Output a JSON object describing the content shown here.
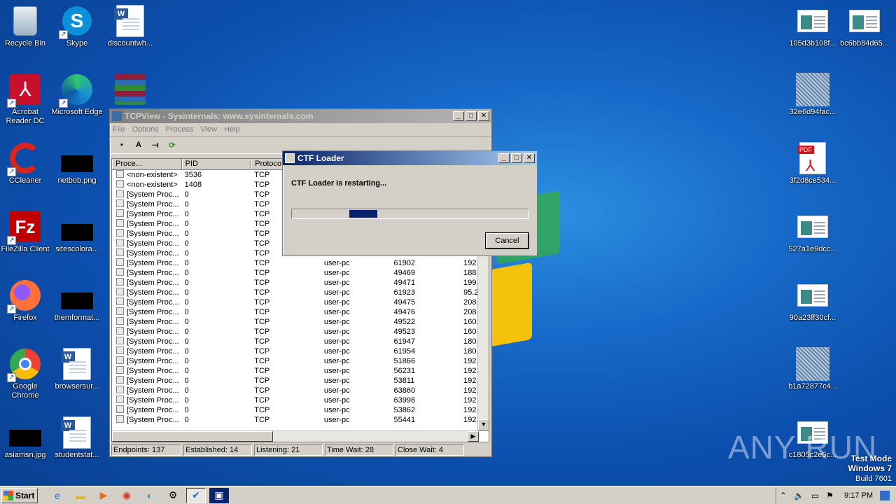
{
  "desktop_left": [
    {
      "label": "Recycle Bin",
      "icon": "recycle-bin-icon"
    },
    {
      "label": "Skype",
      "icon": "skype-icon"
    },
    {
      "label": "discountwh...",
      "icon": "word-doc-icon"
    },
    {
      "label": "Acrobat Reader DC",
      "icon": "acrobat-icon"
    },
    {
      "label": "Microsoft Edge",
      "icon": "edge-icon"
    },
    {
      "label": "",
      "icon": "winrar-icon"
    },
    {
      "label": "CCleaner",
      "icon": "ccleaner-icon"
    },
    {
      "label": "netbob.png",
      "icon": "image-file-icon"
    },
    {
      "label": "FileZilla Client",
      "icon": "filezilla-icon"
    },
    {
      "label": "sitescolora...",
      "icon": "image-file-icon"
    },
    {
      "label": "Firefox",
      "icon": "firefox-icon"
    },
    {
      "label": "themformat...",
      "icon": "image-file-icon"
    },
    {
      "label": "Google Chrome",
      "icon": "chrome-icon"
    },
    {
      "label": "browsersur...",
      "icon": "word-doc-icon"
    },
    {
      "label": "asiamsn.jpg",
      "icon": "image-file-icon"
    },
    {
      "label": "studentstat...",
      "icon": "word-doc-icon"
    }
  ],
  "desktop_right": [
    {
      "label": "105d3b108f...",
      "icon": "screenshot-file-icon"
    },
    {
      "label": "bc6bb84d65...",
      "icon": "screenshot-file-icon"
    },
    {
      "label": "32e6d94fac...",
      "icon": "image-file-icon"
    },
    {
      "label": "3f2d8ce534...",
      "icon": "pdf-icon"
    },
    {
      "label": "527a1e9dcc...",
      "icon": "screenshot-file-icon"
    },
    {
      "label": "90a23ff30cf...",
      "icon": "screenshot-file-icon"
    },
    {
      "label": "b1a72877c4...",
      "icon": "image-file-icon"
    },
    {
      "label": "c1805c2e5c...",
      "icon": "screenshot-file-icon"
    }
  ],
  "tcpview": {
    "title": "TCPView - Sysinternals: www.sysinternals.com",
    "menu": [
      "File",
      "Options",
      "Process",
      "View",
      "Help"
    ],
    "columns": [
      "Proce...",
      "PID",
      "Protoco",
      "",
      "",
      ""
    ],
    "rows": [
      [
        "<non-existent>",
        "3536",
        "TCP",
        "",
        "",
        ""
      ],
      [
        "<non-existent>",
        "1408",
        "TCP",
        "",
        "",
        ""
      ],
      [
        "[System Proc...",
        "0",
        "TCP",
        "",
        "",
        ""
      ],
      [
        "[System Proc...",
        "0",
        "TCP",
        "",
        "",
        ""
      ],
      [
        "[System Proc...",
        "0",
        "TCP",
        "",
        "",
        ""
      ],
      [
        "[System Proc...",
        "0",
        "TCP",
        "",
        "",
        ""
      ],
      [
        "[System Proc...",
        "0",
        "TCP",
        "",
        "",
        ""
      ],
      [
        "[System Proc...",
        "0",
        "TCP",
        "",
        "",
        ""
      ],
      [
        "[System Proc...",
        "0",
        "TCP",
        "",
        "",
        ""
      ],
      [
        "[System Proc...",
        "0",
        "TCP",
        "user-pc",
        "61902",
        "192."
      ],
      [
        "[System Proc...",
        "0",
        "TCP",
        "user-pc",
        "49469",
        "188."
      ],
      [
        "[System Proc...",
        "0",
        "TCP",
        "user-pc",
        "49471",
        "199."
      ],
      [
        "[System Proc...",
        "0",
        "TCP",
        "user-pc",
        "61923",
        "95.2"
      ],
      [
        "[System Proc...",
        "0",
        "TCP",
        "user-pc",
        "49475",
        "208."
      ],
      [
        "[System Proc...",
        "0",
        "TCP",
        "user-pc",
        "49476",
        "208."
      ],
      [
        "[System Proc...",
        "0",
        "TCP",
        "user-pc",
        "49522",
        "160."
      ],
      [
        "[System Proc...",
        "0",
        "TCP",
        "user-pc",
        "49523",
        "160."
      ],
      [
        "[System Proc...",
        "0",
        "TCP",
        "user-pc",
        "61947",
        "180."
      ],
      [
        "[System Proc...",
        "0",
        "TCP",
        "user-pc",
        "61954",
        "180."
      ],
      [
        "[System Proc...",
        "0",
        "TCP",
        "user-pc",
        "51866",
        "192."
      ],
      [
        "[System Proc...",
        "0",
        "TCP",
        "user-pc",
        "56231",
        "192."
      ],
      [
        "[System Proc...",
        "0",
        "TCP",
        "user-pc",
        "53811",
        "192."
      ],
      [
        "[System Proc...",
        "0",
        "TCP",
        "user-pc",
        "63860",
        "192."
      ],
      [
        "[System Proc...",
        "0",
        "TCP",
        "user-pc",
        "63998",
        "192."
      ],
      [
        "[System Proc...",
        "0",
        "TCP",
        "user-pc",
        "53862",
        "192."
      ],
      [
        "[System Proc...",
        "0",
        "TCP",
        "user-pc",
        "55441",
        "192."
      ]
    ],
    "status": {
      "endpoints": "Endpoints: 137",
      "established": "Established: 14",
      "listening": "Listening: 21",
      "time_wait": "Time Wait: 28",
      "close_wait": "Close Wait: 4"
    }
  },
  "ctf_dialog": {
    "title": "CTF Loader",
    "message": "CTF Loader is restarting...",
    "cancel": "Cancel"
  },
  "watermark": {
    "brand": "ANY RUN",
    "test_mode": "Test Mode",
    "os": "Windows 7",
    "build": "Build 7601"
  },
  "taskbar": {
    "start": "Start",
    "clock": "9:17 PM"
  },
  "colors": {
    "desktop": "#0c4fae",
    "progress": "#0a246a",
    "titlebar_active": "#0a246a",
    "titlebar_inactive": "#808080"
  }
}
